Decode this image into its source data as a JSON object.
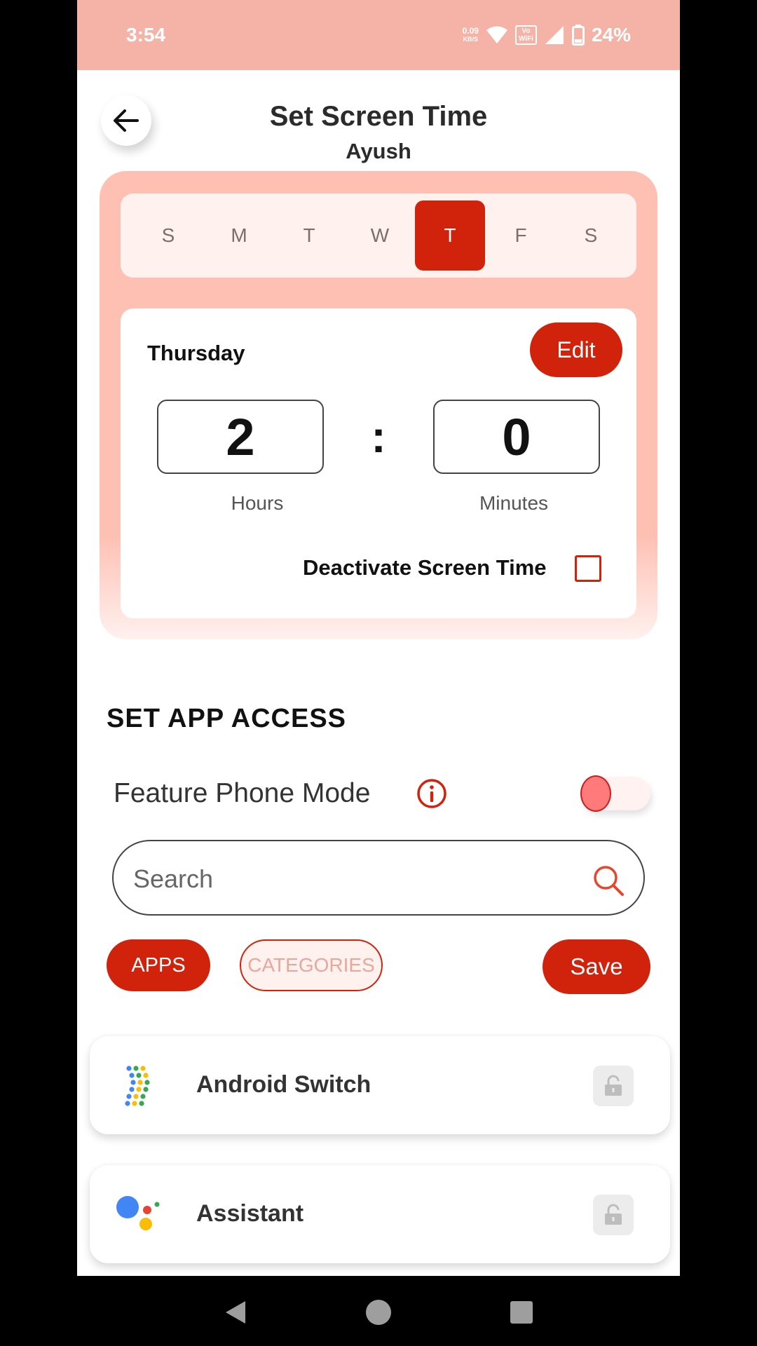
{
  "status_bar": {
    "time": "3:54",
    "net_speed_value": "0.09",
    "net_speed_unit": "KB/S",
    "volte_top": "Vo",
    "volte_bottom": "WiFi",
    "battery": "24%"
  },
  "header": {
    "title": "Set Screen Time",
    "subtitle": "Ayush"
  },
  "schedule": {
    "days": [
      "S",
      "M",
      "T",
      "W",
      "T",
      "F",
      "S"
    ],
    "active_day_index": 4,
    "selected_day_name": "Thursday",
    "edit_label": "Edit",
    "hours_value": "2",
    "minutes_value": "0",
    "separator": ":",
    "hours_label": "Hours",
    "minutes_label": "Minutes",
    "deactivate_label": "Deactivate Screen Time",
    "deactivate_checked": false
  },
  "app_access": {
    "section_title": "SET APP ACCESS",
    "feature_phone_label": "Feature Phone Mode",
    "feature_phone_enabled": false,
    "search_placeholder": "Search",
    "tabs": {
      "apps": "APPS",
      "categories": "CATEGORIES"
    },
    "save_label": "Save",
    "apps": [
      {
        "name": "Android Switch",
        "icon": "android-switch-icon"
      },
      {
        "name": "Assistant",
        "icon": "assistant-icon"
      }
    ]
  },
  "colors": {
    "accent": "#d1220b",
    "status_bar": "#f5b3a7",
    "card_bg": "#ffc0b4"
  }
}
